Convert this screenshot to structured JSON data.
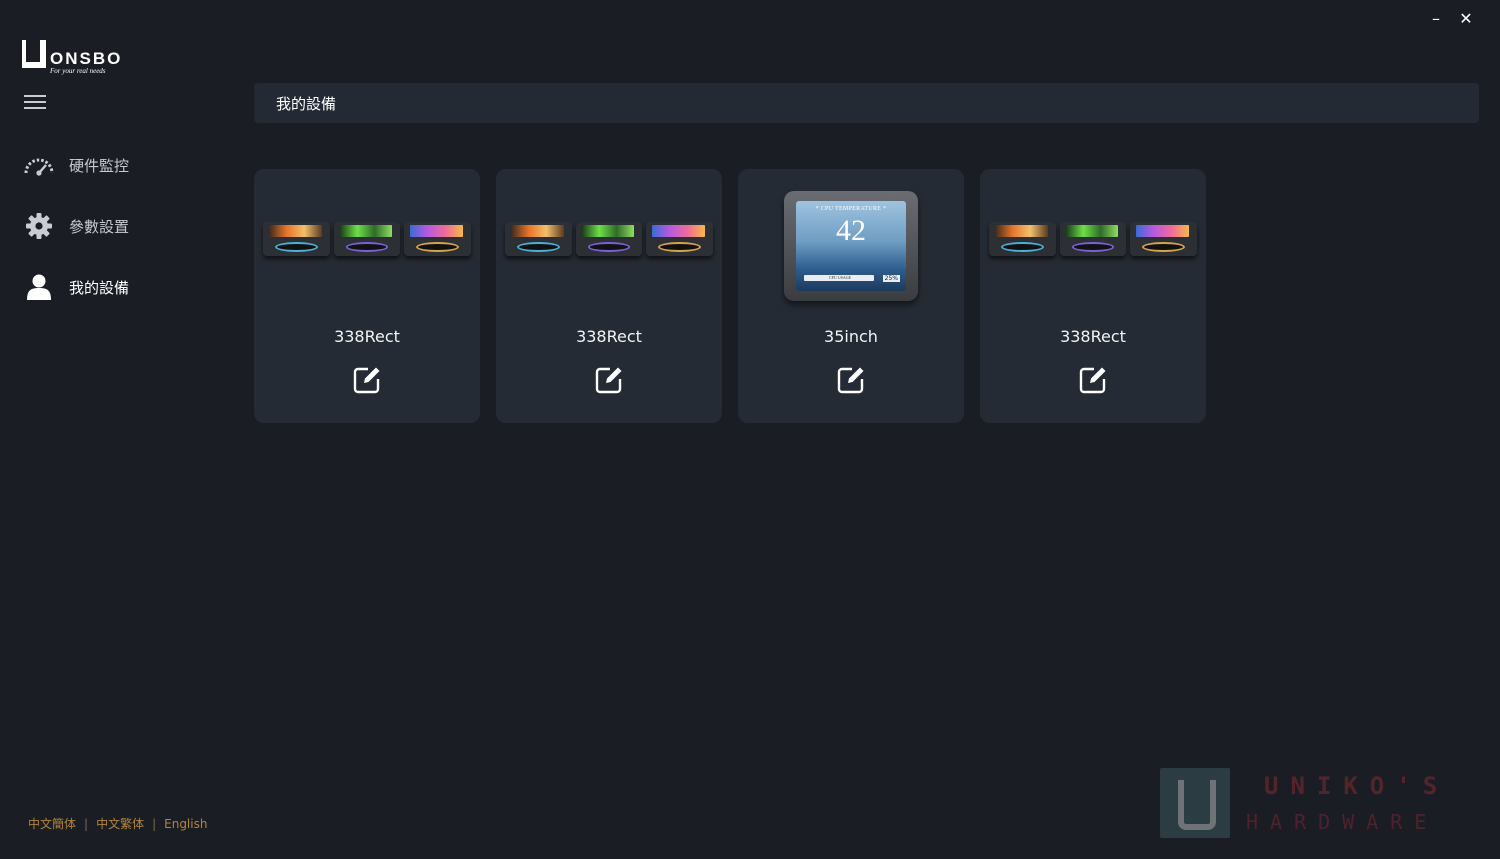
{
  "window": {
    "minimize_glyph": "–",
    "close_glyph": "✕"
  },
  "brand": {
    "logo_text": "ONSBO",
    "tagline": "For your real needs"
  },
  "sidebar": {
    "items": [
      {
        "label": "硬件監控",
        "icon": "speedometer-icon",
        "active": false
      },
      {
        "label": "參數設置",
        "icon": "gear-icon",
        "active": false
      },
      {
        "label": "我的設備",
        "icon": "user-icon",
        "active": true
      }
    ]
  },
  "header": {
    "title": "我的設備"
  },
  "devices": [
    {
      "name": "338Rect",
      "thumbnail": "338rect-display-image"
    },
    {
      "name": "338Rect",
      "thumbnail": "338rect-display-image"
    },
    {
      "name": "35inch",
      "thumbnail": "35inch-display-image",
      "screen": {
        "title": "* CPU TEMPERATURE *",
        "value": "42",
        "usage_label": "CPU USAGE",
        "usage_value": "25%"
      }
    },
    {
      "name": "338Rect",
      "thumbnail": "338rect-display-image"
    }
  ],
  "languages": [
    "中文簡体",
    "中文繁体",
    "English"
  ],
  "watermark": {
    "line1": "UNIKO'S",
    "line2": "HARDWARE"
  },
  "colors": {
    "background": "#1a1d23",
    "card": "#252b34",
    "header_bar": "#242a33",
    "language_text": "#b0843d"
  }
}
